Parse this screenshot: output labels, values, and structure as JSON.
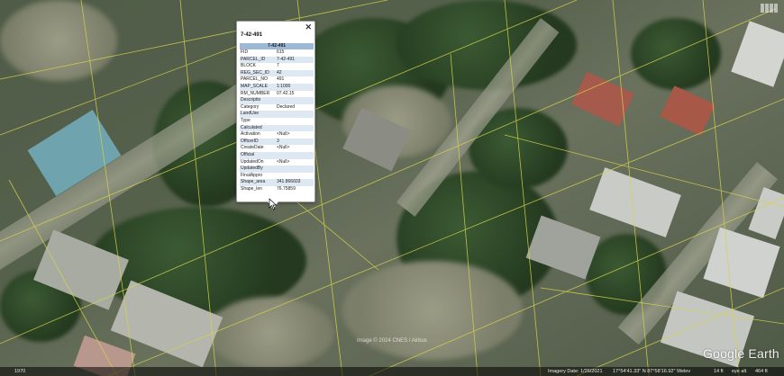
{
  "popup": {
    "title": "7-42-491",
    "close_icon": "close-icon",
    "table_header": "7-42-491",
    "rows": [
      {
        "key": "FID",
        "value": "615"
      },
      {
        "key": "PARCEL_ID",
        "value": "7-42-491"
      },
      {
        "key": "BLOCK",
        "value": "7"
      },
      {
        "key": "REG_SEC_ID",
        "value": "42"
      },
      {
        "key": "PARCEL_NO",
        "value": "491"
      },
      {
        "key": "MAP_SCALE",
        "value": "1:1000"
      },
      {
        "key": "RM_NUMBER",
        "value": "07.42.15"
      },
      {
        "key": "Descriptio",
        "value": ""
      },
      {
        "key": "Category",
        "value": "Declared"
      },
      {
        "key": "LandUse",
        "value": ""
      },
      {
        "key": "Type",
        "value": ""
      },
      {
        "key": "Calculated",
        "value": ""
      },
      {
        "key": "Activation",
        "value": "<Null>"
      },
      {
        "key": "OfficerID",
        "value": "3"
      },
      {
        "key": "CreateDate",
        "value": "<Null>"
      },
      {
        "key": "Official",
        "value": ""
      },
      {
        "key": "UpdatedOn",
        "value": "<Null>"
      },
      {
        "key": "UpdatedBy",
        "value": ""
      },
      {
        "key": "FinalAppro",
        "value": ""
      },
      {
        "key": "Shape_area",
        "value": "341.866603"
      },
      {
        "key": "Shape_len",
        "value": "76.75859"
      }
    ]
  },
  "map": {
    "attribution": "Image © 2024 CNES / Airbus",
    "logo": "Google Earth",
    "top_right_icon": "tour-icon"
  },
  "statusbar": {
    "left": "1970",
    "imagery_date": "Imagery Date: 1/26/2021",
    "coordinates": "17°54'41.33\" N   87°58'16.92\" W",
    "elev_label": "elev",
    "elev_value": "14 ft",
    "eye_alt_label": "eye alt",
    "eye_alt_value": "464 ft"
  }
}
